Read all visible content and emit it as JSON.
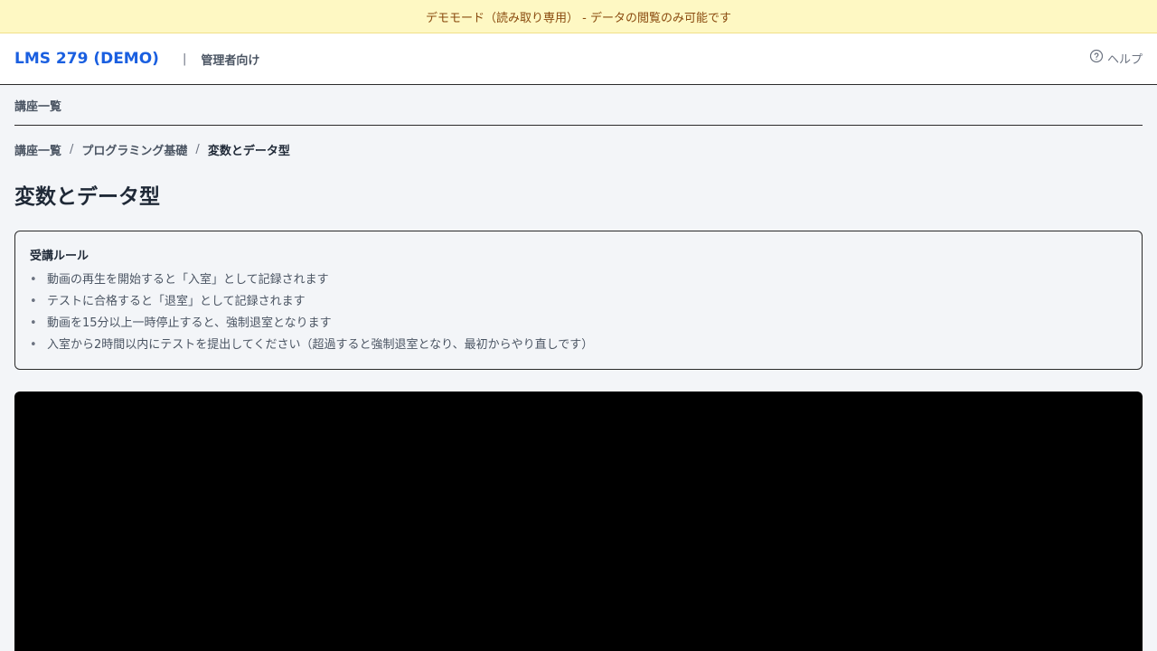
{
  "banner": {
    "text": "デモモード（読み取り専用） - データの閲覧のみ可能です"
  },
  "header": {
    "brand": "LMS 279 (DEMO)",
    "separator": "|",
    "subtitle": "管理者向け",
    "help_label": "ヘルプ"
  },
  "subnav": {
    "item": "講座一覧"
  },
  "breadcrumb": {
    "items": [
      {
        "label": "講座一覧"
      },
      {
        "label": "プログラミング基礎"
      }
    ],
    "current": "変数とデータ型",
    "separator": "/"
  },
  "page": {
    "title": "変数とデータ型"
  },
  "rules": {
    "title": "受講ルール",
    "items": [
      "動画の再生を開始すると「入室」として記録されます",
      "テストに合格すると「退室」として記録されます",
      "動画を15分以上一時停止すると、強制退室となります",
      "入室から2時間以内にテストを提出してください（超過すると強制退室となり、最初からやり直しです）"
    ]
  },
  "colors": {
    "accent": "#1a5fe0",
    "banner_bg": "#fef8c3",
    "banner_text": "#8a4b0f"
  },
  "icons": {
    "help": "question-circle-icon"
  }
}
